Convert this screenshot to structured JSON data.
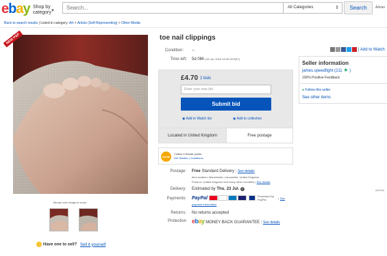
{
  "header": {
    "logo": {
      "e": "e",
      "b": "b",
      "a": "a",
      "y": "y"
    },
    "shop_by_line1": "Shop by",
    "shop_by_line2": "category",
    "search_placeholder": "Search...",
    "category_selected": "All Categories",
    "search_button": "Search",
    "advanced": "Advan"
  },
  "breadcrumb": {
    "back": "Back to search results",
    "listed_in": "| Listed in category:",
    "items": [
      "Art",
      "Artists (Self-Representing)",
      "Other Media"
    ],
    "sep": ">"
  },
  "gallery": {
    "ribbon": "NEW P&P",
    "zoom_hint": "Mouse over image to zoom"
  },
  "item": {
    "title": "toe nail clippings",
    "condition_label": "Condition:",
    "condition_value": "--",
    "time_left_label": "Time left:",
    "time_left_value": "5d 06h",
    "end_time": "(20 Jul, 2015   19:20:29 BST)"
  },
  "share": {
    "icons": [
      "email-icon",
      "print-icon",
      "facebook-icon",
      "twitter-icon",
      "pinterest-icon"
    ],
    "add_to_watch": "| Add to Watch"
  },
  "bid": {
    "price": "£4.70",
    "bids": "2 bids",
    "max_bid_placeholder": "Enter your max bid",
    "submit": "Submit bid",
    "add_to_watch": "Add to Watch list",
    "add_to_collection": "Add to collection",
    "location": "Located in United Kingdom",
    "free_postage": "Free postage"
  },
  "nectar": {
    "badge": "nectar",
    "line1": "Collect 4 Nectar points",
    "line2": "Get Started | Conditions"
  },
  "details": {
    "postage_label": "Postage:",
    "postage_free": "Free",
    "postage_type": "Standard Delivery",
    "postage_see": "See details",
    "item_location": "Item location:  Manchester, Lancashire, United Kingdom",
    "posts_to": "Posts to:  United Kingdom and many other countries",
    "posts_see": "See details",
    "delivery_label": "Delivery:",
    "delivery_value": "Estimated by",
    "delivery_date": "Thu. 23 Jul.",
    "payments_label": "Payments:",
    "paypal": "PayPal",
    "processed_by": "Processed by PayPal",
    "payments_see": "See",
    "payment_info": "payment information",
    "returns_label": "Returns:",
    "returns_value": "No returns accepted",
    "protection_label": "Protection",
    "ebay_mbg": "MONEY BACK GUARANTEE",
    "protection_see": "See details"
  },
  "seller": {
    "heading": "Seller information",
    "name": "james.speedfight",
    "score": "(211",
    "close": ")",
    "positive": "100% Positive Feedback",
    "follow": "Follow this seller",
    "other_items": "See other items"
  },
  "footer": {
    "have_one": "Have one to sell?",
    "sell_it": "Sell it yourself",
    "adchoice": "AdChoi"
  },
  "colors": {
    "link": "#0654ba",
    "submit": "#0654ba",
    "ebay_red": "#e53238",
    "ebay_blue": "#0064d2",
    "ebay_yellow": "#f5af02",
    "ebay_green": "#86b817"
  }
}
